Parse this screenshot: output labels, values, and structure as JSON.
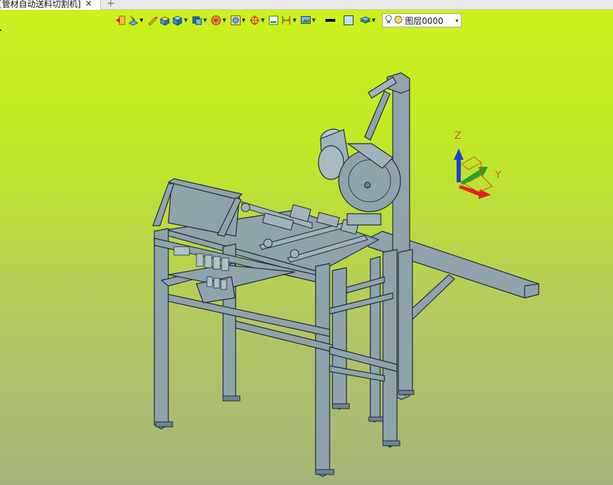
{
  "tab": {
    "title": "[管材自动送料切割机]",
    "close_glyph": "✕",
    "add_glyph": "+"
  },
  "toolbar": {
    "items": [
      {
        "icon": "exit-sketch-icon",
        "has_dropdown": false
      },
      {
        "icon": "sketch-plane-icon",
        "has_dropdown": true
      },
      {
        "icon": "pencil-icon",
        "has_dropdown": false
      },
      {
        "icon": "feature-box-icon",
        "has_dropdown": false
      },
      {
        "icon": "solid-cube-icon",
        "has_dropdown": true
      },
      {
        "icon": "surface-icon",
        "has_dropdown": true
      },
      {
        "icon": "globe-icon",
        "has_dropdown": true
      },
      {
        "icon": "view-orient-icon",
        "has_dropdown": true
      },
      {
        "icon": "target-icon",
        "has_dropdown": true
      },
      {
        "icon": "display-box-icon",
        "has_dropdown": false
      },
      {
        "icon": "dimension-icon",
        "has_dropdown": true
      },
      {
        "icon": "render-icon",
        "has_dropdown": true
      },
      {
        "icon": "line-color-icon",
        "has_dropdown": false
      },
      {
        "icon": "fill-color-icon",
        "has_dropdown": false
      },
      {
        "icon": "layer-stack-icon",
        "has_dropdown": true
      }
    ],
    "layer": {
      "name": "图层0000",
      "dropdown_glyph": "▾"
    }
  },
  "axes": {
    "x_label": "X",
    "y_label": "Y",
    "z_label": "Z"
  },
  "colors": {
    "background_top": "#cbf21c",
    "background_bottom": "#a5b47a",
    "model": "#8fa3ad",
    "model_edge": "#1e2a30",
    "axis_x": "#e02020",
    "axis_y": "#2ca02c",
    "axis_z": "#1f3fd0"
  }
}
